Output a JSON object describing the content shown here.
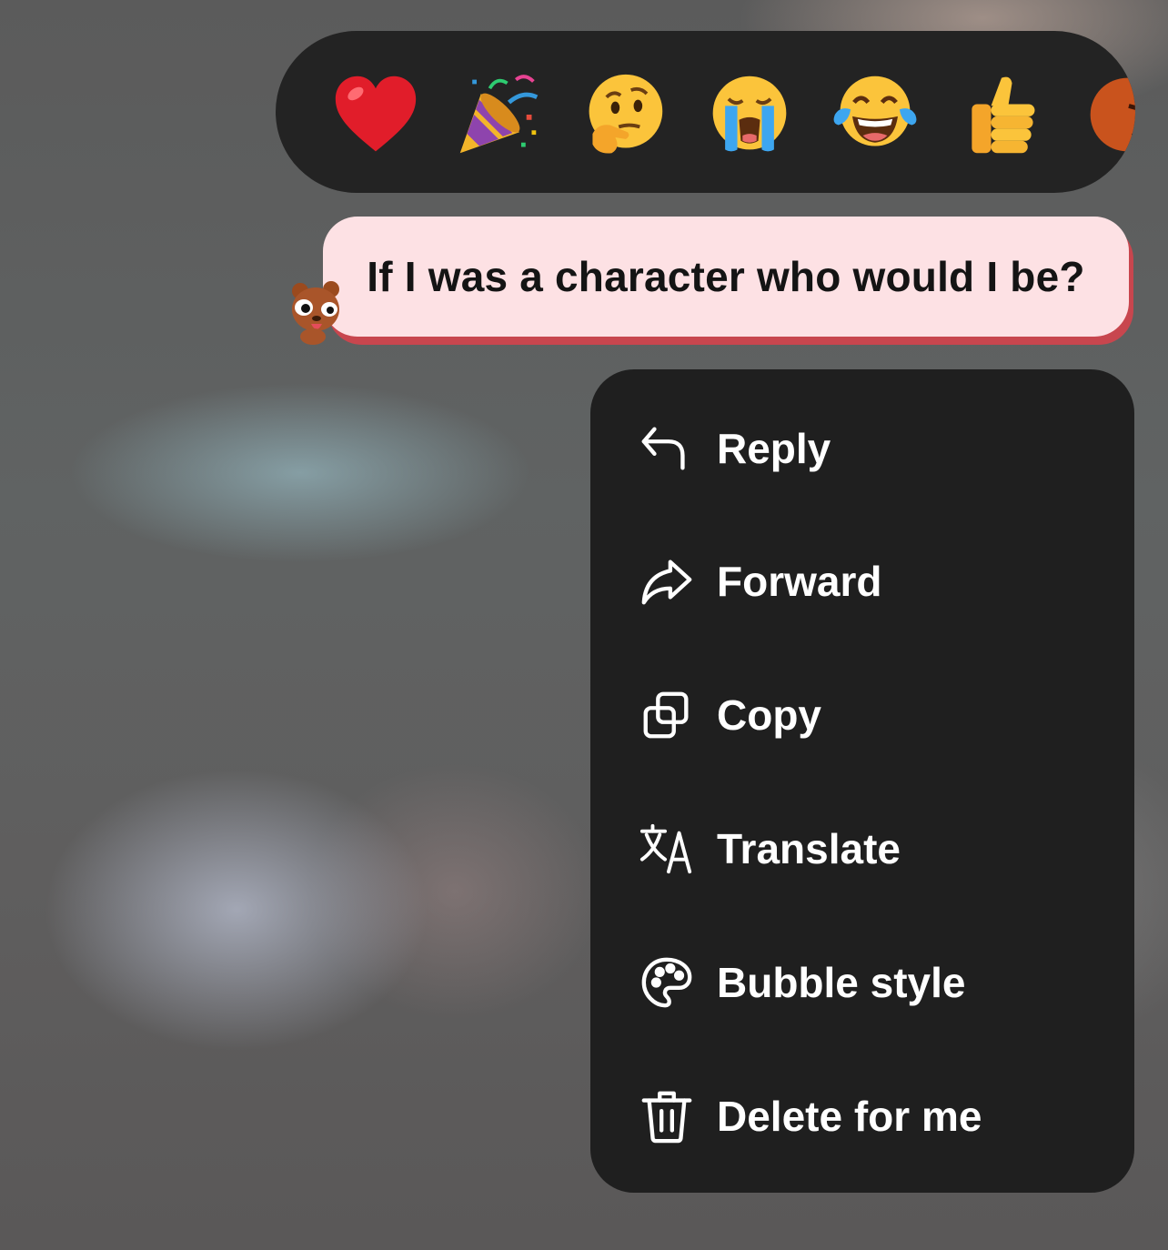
{
  "reactions": [
    {
      "name": "heart",
      "icon": "red-heart-icon"
    },
    {
      "name": "party",
      "icon": "party-popper-icon"
    },
    {
      "name": "thinking",
      "icon": "thinking-face-icon"
    },
    {
      "name": "crying",
      "icon": "loudly-crying-face-icon"
    },
    {
      "name": "laughing",
      "icon": "tears-of-joy-face-icon"
    },
    {
      "name": "thumbs_up",
      "icon": "thumbs-up-icon"
    },
    {
      "name": "angry",
      "icon": "angry-face-icon"
    }
  ],
  "message": {
    "text": "If I was a character who would I be?",
    "avatar_icon": "bear-sticker-icon",
    "bubble_color": "#fde1e4",
    "bubble_shadow_color": "#c8464e"
  },
  "menu": {
    "items": [
      {
        "label": "Reply",
        "icon": "reply-arrow-icon"
      },
      {
        "label": "Forward",
        "icon": "forward-arrow-icon"
      },
      {
        "label": "Copy",
        "icon": "copy-icon"
      },
      {
        "label": "Translate",
        "icon": "translate-icon"
      },
      {
        "label": "Bubble style",
        "icon": "palette-icon"
      },
      {
        "label": "Delete for me",
        "icon": "trash-icon"
      }
    ]
  }
}
